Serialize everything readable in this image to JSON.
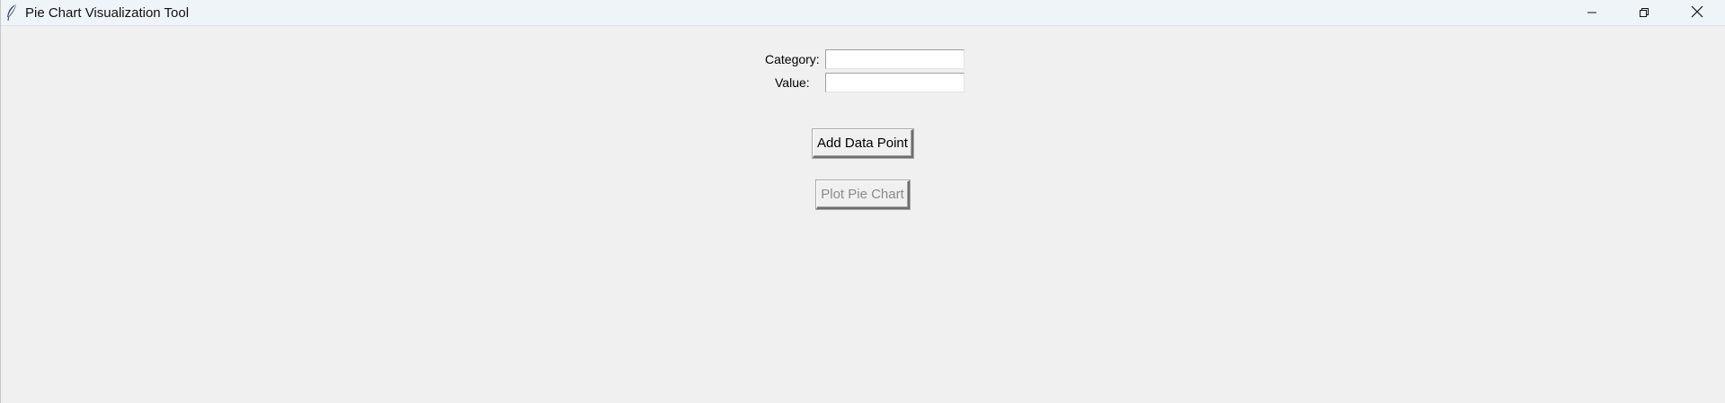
{
  "window": {
    "title": "Pie Chart Visualization Tool",
    "icon": "feather-icon",
    "controls": {
      "minimize_icon": "minimize-icon",
      "maximize_icon": "restore-icon",
      "close_icon": "close-icon"
    }
  },
  "form": {
    "category_label": "Category:",
    "category_value": "",
    "value_label": "Value:",
    "value_value": "",
    "add_button_label": "Add Data Point",
    "plot_button_label": "Plot Pie Chart",
    "plot_button_state": "disabled"
  },
  "colors": {
    "background": "#f0f0f0",
    "titlebar": "#eff4f9",
    "disabled_text": "#8a8a8a"
  }
}
